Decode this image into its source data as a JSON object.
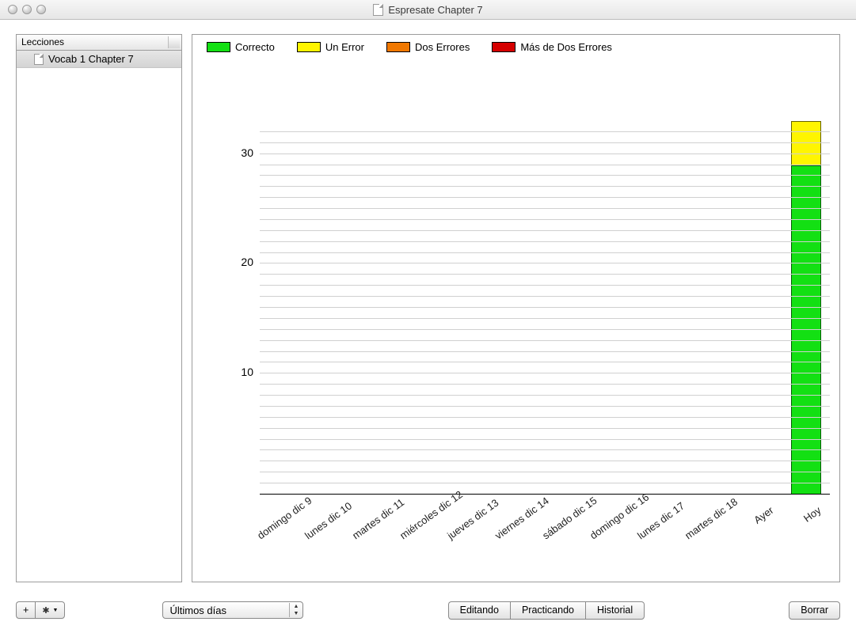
{
  "window": {
    "title": "Espresate Chapter 7"
  },
  "sidebar": {
    "header": "Lecciones",
    "items": [
      {
        "label": "Vocab 1 Chapter 7"
      }
    ]
  },
  "legend": [
    {
      "label": "Correcto",
      "color": "#13e013"
    },
    {
      "label": "Un Error",
      "color": "#fff500"
    },
    {
      "label": "Dos Errores",
      "color": "#f07800"
    },
    {
      "label": "Más de Dos Errores",
      "color": "#d50000"
    }
  ],
  "chart_data": {
    "type": "bar",
    "ylabel": "",
    "xlabel": "",
    "ylim": [
      0,
      34
    ],
    "yticks": [
      10,
      20,
      30
    ],
    "categories": [
      "domingo dic 9",
      "lunes dic 10",
      "martes dic 11",
      "miércoles dic 12",
      "jueves dic 13",
      "viernes dic 14",
      "sábado dic 15",
      "domingo dic 16",
      "lunes dic 17",
      "martes dic 18",
      "Ayer",
      "Hoy"
    ],
    "series": [
      {
        "name": "Correcto",
        "color": "#13e013",
        "values": [
          0,
          0,
          0,
          0,
          0,
          0,
          0,
          0,
          0,
          0,
          0,
          30
        ]
      },
      {
        "name": "Un Error",
        "color": "#fff500",
        "values": [
          0,
          0,
          0,
          0,
          0,
          0,
          0,
          0,
          0,
          0,
          0,
          4
        ]
      },
      {
        "name": "Dos Errores",
        "color": "#f07800",
        "values": [
          0,
          0,
          0,
          0,
          0,
          0,
          0,
          0,
          0,
          0,
          0,
          0
        ]
      },
      {
        "name": "Más de Dos Errores",
        "color": "#d50000",
        "values": [
          0,
          0,
          0,
          0,
          0,
          0,
          0,
          0,
          0,
          0,
          0,
          0
        ]
      }
    ]
  },
  "toolbar": {
    "popup_value": "Últimos días",
    "seg_edit": "Editando",
    "seg_practice": "Practicando",
    "seg_history": "Historial",
    "clear": "Borrar"
  }
}
